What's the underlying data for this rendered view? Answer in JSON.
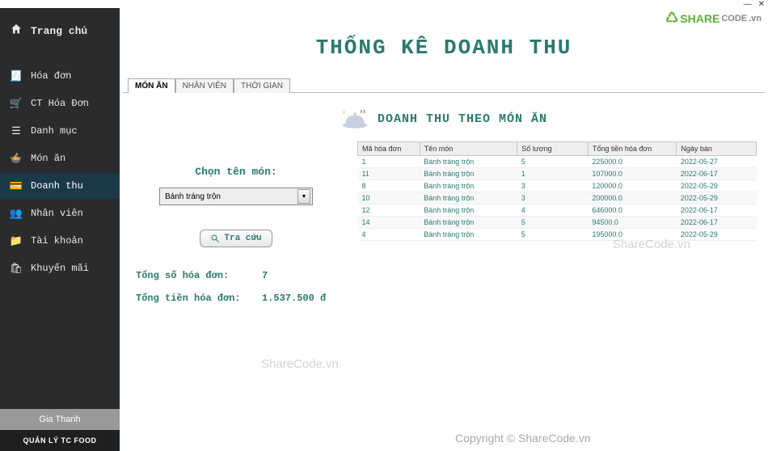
{
  "window": {
    "minimize": "—",
    "close": "✕"
  },
  "brand": {
    "name1": "SHARE",
    "name2": "CODE",
    "suffix": ".vn"
  },
  "sidebar": {
    "home": "Trang chủ",
    "items": [
      {
        "icon": "🧾",
        "label": "Hóa đơn"
      },
      {
        "icon": "🛒",
        "label": "CT Hóa Đơn"
      },
      {
        "icon": "☰",
        "label": "Danh mục"
      },
      {
        "icon": "🍲",
        "label": "Món ăn"
      },
      {
        "icon": "💳",
        "label": "Doanh thu"
      },
      {
        "icon": "👥",
        "label": "Nhân viên"
      },
      {
        "icon": "📁",
        "label": "Tài khoản"
      },
      {
        "icon": "🛍",
        "label": "Khuyến mãi"
      }
    ],
    "user": "Gia Thanh",
    "appname": "QUẢN LÝ TC FOOD"
  },
  "page": {
    "title": "THỐNG KÊ DOANH THU",
    "tabs": [
      "MÓN ĂN",
      "NHÂN VIÊN",
      "THỜI GIAN"
    ],
    "section_heading": "DOANH THU THEO MÓN ĂN",
    "filter_label": "Chọn tên món:",
    "filter_value": "Bánh tráng trộn",
    "search_btn": "Tra cứu"
  },
  "table": {
    "headers": [
      "Mã hóa đơn",
      "Tên món",
      "Số lượng",
      "Tổng tiền hóa đơn",
      "Ngày bán"
    ],
    "rows": [
      [
        "1",
        "Bánh tráng trộn",
        "5",
        "225000.0",
        "2022-05-27"
      ],
      [
        "11",
        "Bánh tráng trộn",
        "1",
        "107000.0",
        "2022-06-17"
      ],
      [
        "8",
        "Bánh tráng trộn",
        "3",
        "120000.0",
        "2022-05-29"
      ],
      [
        "10",
        "Bánh tráng trộn",
        "3",
        "200000.0",
        "2022-05-29"
      ],
      [
        "12",
        "Bánh tráng trộn",
        "4",
        "646000.0",
        "2022-06-17"
      ],
      [
        "14",
        "Bánh tráng trộn",
        "5",
        "94500.0",
        "2022-06-17"
      ],
      [
        "4",
        "Bánh tráng trộn",
        "5",
        "195000.0",
        "2022-05-29"
      ]
    ]
  },
  "summary": {
    "count_label": "Tổng số hóa đơn:",
    "count_value": "7",
    "total_label": "Tổng tiền hóa đơn:",
    "total_value": "1.537.500 đ"
  },
  "watermarks": {
    "wm_small": "ShareCode.vn",
    "wm_copy": "Copyright © ShareCode.vn"
  }
}
